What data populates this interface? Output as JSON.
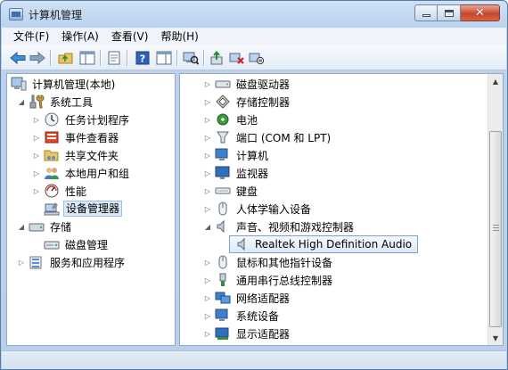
{
  "window": {
    "title": "计算机管理",
    "colors": {
      "frame": "#b7d0ec",
      "selection": "#dce9f8",
      "close_button": "#c7462c"
    }
  },
  "menubar": {
    "items": [
      "文件(F)",
      "操作(A)",
      "查看(V)",
      "帮助(H)"
    ]
  },
  "toolbar": {
    "buttons": [
      "back-arrow-icon",
      "forward-arrow-icon",
      "up-folder-icon",
      "show-hide-tree-icon",
      "properties-icon",
      "help-icon",
      "action-pane-icon",
      "scan-hardware-icon",
      "update-driver-icon",
      "uninstall-device-icon",
      "disable-device-icon"
    ]
  },
  "left_tree": {
    "root": "计算机管理(本地)",
    "system_tools": "系统工具",
    "task_scheduler": "任务计划程序",
    "event_viewer": "事件查看器",
    "shared_folders": "共享文件夹",
    "local_users": "本地用户和组",
    "performance": "性能",
    "device_manager": "设备管理器",
    "storage": "存储",
    "disk_management": "磁盘管理",
    "services_apps": "服务和应用程序"
  },
  "device_tree": {
    "items": [
      "磁盘驱动器",
      "存储控制器",
      "电池",
      "端口 (COM 和 LPT)",
      "计算机",
      "监视器",
      "键盘",
      "人体学输入设备",
      "声音、视频和游戏控制器",
      "Realtek High Definition Audio",
      "鼠标和其他指针设备",
      "通用串行总线控制器",
      "网络适配器",
      "系统设备",
      "显示适配器"
    ]
  }
}
